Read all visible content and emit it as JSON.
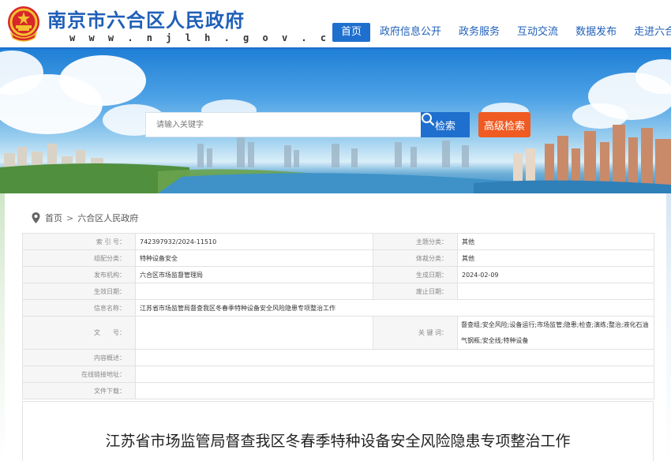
{
  "site": {
    "title": "南京市六合区人民政府",
    "url": "w w w . n j l h . g o v . c n",
    "emblem_icon": "national-emblem-icon"
  },
  "nav": {
    "items": [
      {
        "label": "首页",
        "active": true
      },
      {
        "label": "政府信息公开"
      },
      {
        "label": "政务服务"
      },
      {
        "label": "互动交流"
      },
      {
        "label": "数据发布"
      },
      {
        "label": "走进六合"
      }
    ]
  },
  "search": {
    "placeholder": "请输入关键字",
    "button_label": "检索",
    "advanced_label": "高级检索"
  },
  "breadcrumb": {
    "items": [
      "首页",
      "六合区人民政府"
    ],
    "separator": ">"
  },
  "info": {
    "index_no_label": "索 引 号：",
    "index_no": "742397932/2024-11510",
    "topic_label": "主题分类：",
    "topic": "其他",
    "category_label": "组配分类：",
    "category": "特种设备安全",
    "genre_label": "体裁分类：",
    "genre": "其他",
    "publisher_label": "发布机构：",
    "publisher": "六合区市场监督管理局",
    "date_label": "生成日期：",
    "date": "2024-02-09",
    "effective_label": "生效日期：",
    "effective": "",
    "expire_label": "废止日期：",
    "expire": "",
    "name_label": "信息名称：",
    "name": "江苏省市场监管局督查我区冬春季特种设备安全风险隐患专项整治工作",
    "docno_label": "文　　号：",
    "docno": "",
    "keywords_label": "关 键 词：",
    "keywords": "督查组;安全风险;设备运行;市场监管;隐患;检查;演练;整治;液化石油气钢瓶;安全线;特种设备",
    "summary_label": "内容概述：",
    "summary": "",
    "link_label": "在线链接地址：",
    "link": "",
    "download_label": "文件下载：",
    "download": ""
  },
  "article": {
    "title": "江苏省市场监管局督查我区冬春季特种设备安全风险隐患专项整治工作"
  },
  "colors": {
    "brand_blue": "#1f6fce",
    "title_blue": "#1f5fb8",
    "advanced_orange": "#ef5b22"
  }
}
